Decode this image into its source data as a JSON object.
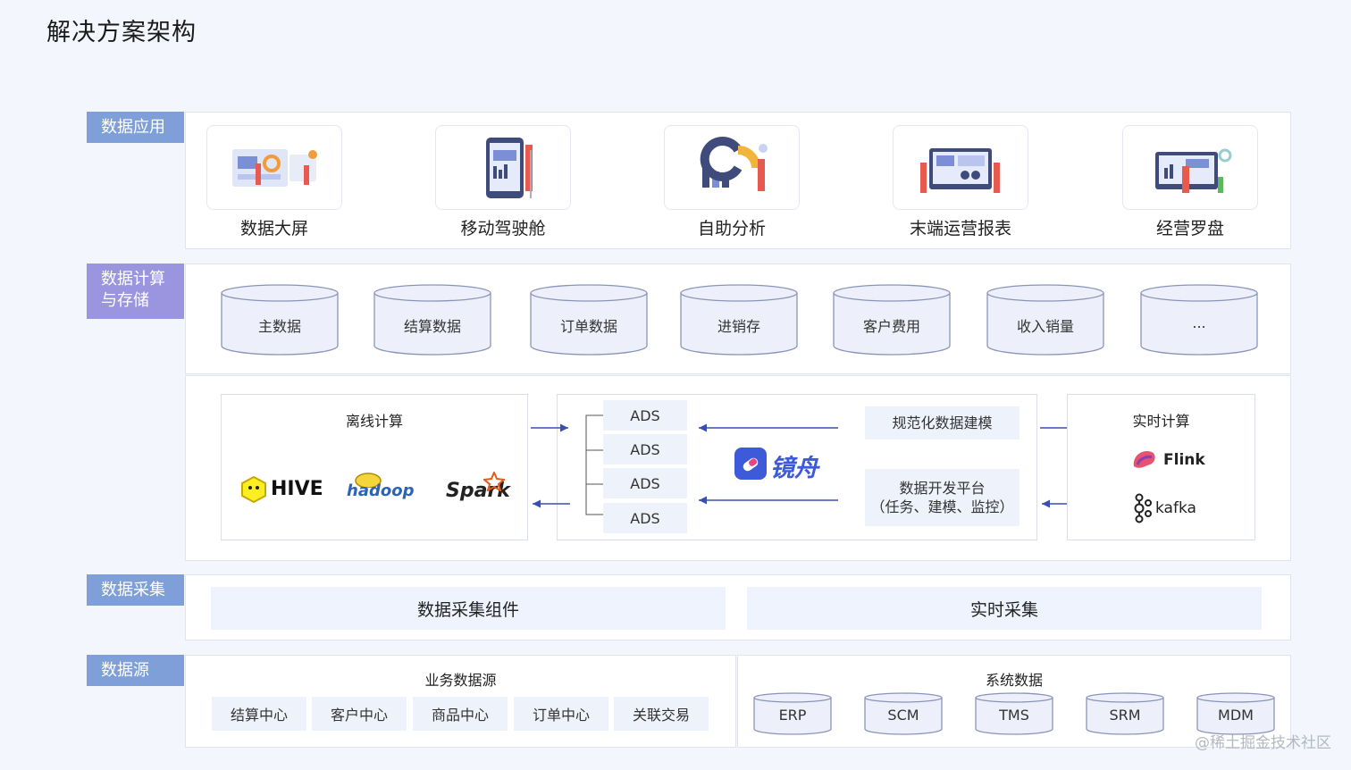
{
  "title": "解决方案架构",
  "layers": {
    "app": "数据应用",
    "compute": "数据计算\n与存储",
    "collect": "数据采集",
    "source": "数据源"
  },
  "apps": [
    "数据大屏",
    "移动驾驶舱",
    "自助分析",
    "末端运营报表",
    "经营罗盘"
  ],
  "storage": [
    "主数据",
    "结算数据",
    "订单数据",
    "进销存",
    "客户费用",
    "收入销量",
    "..."
  ],
  "offline": {
    "title": "离线计算",
    "tools": [
      "HIVE",
      "hadoop",
      "Spark"
    ]
  },
  "ads": [
    "ADS",
    "ADS",
    "ADS",
    "ADS"
  ],
  "center_logo": "镜舟",
  "modeling": "规范化数据建模",
  "dev_platform": {
    "line1": "数据开发平台",
    "line2": "（任务、建模、监控）"
  },
  "realtime": {
    "title": "实时计算",
    "tools": [
      "Flink",
      "kafka"
    ]
  },
  "collection": [
    "数据采集组件",
    "实时采集"
  ],
  "business": {
    "title": "业务数据源",
    "items": [
      "结算中心",
      "客户中心",
      "商品中心",
      "订单中心",
      "关联交易"
    ]
  },
  "system": {
    "title": "系统数据",
    "items": [
      "ERP",
      "SCM",
      "TMS",
      "SRM",
      "MDM"
    ]
  },
  "watermark": "@稀土掘金技术社区",
  "colors": {
    "tag_blue": "#7f9fd9",
    "tag_purple": "#9b95df",
    "cylinder": "#edf0fa",
    "arrow": "#3a4fb0",
    "accent": "#3d5bd9"
  }
}
